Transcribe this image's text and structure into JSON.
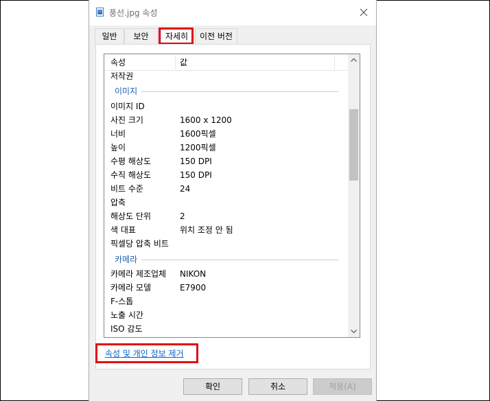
{
  "window": {
    "title": "풍선.jpg 속성"
  },
  "tabs": [
    {
      "label": "일반",
      "active": false
    },
    {
      "label": "보안",
      "active": false
    },
    {
      "label": "자세히",
      "active": true
    },
    {
      "label": "이전 버전",
      "active": false
    }
  ],
  "list": {
    "headers": {
      "name": "속성",
      "value": "값"
    },
    "top_rows": [
      {
        "name": "저작권",
        "value": ""
      }
    ],
    "group_image": {
      "label": "이미지",
      "rows": [
        {
          "name": "이미지 ID",
          "value": ""
        },
        {
          "name": "사진 크기",
          "value": "1600 x 1200"
        },
        {
          "name": "너비",
          "value": "1600픽셀"
        },
        {
          "name": "높이",
          "value": "1200픽셀"
        },
        {
          "name": "수평 해상도",
          "value": "150 DPI"
        },
        {
          "name": "수직 해상도",
          "value": "150 DPI"
        },
        {
          "name": "비트 수준",
          "value": "24"
        },
        {
          "name": "압축",
          "value": ""
        },
        {
          "name": "해상도 단위",
          "value": "2"
        },
        {
          "name": "색 대표",
          "value": "위치 조정 안 됨"
        },
        {
          "name": "픽셀당 압축 비트",
          "value": ""
        }
      ]
    },
    "group_camera": {
      "label": "카메라",
      "rows": [
        {
          "name": "카메라 제조업체",
          "value": "NIKON"
        },
        {
          "name": "카메라 모델",
          "value": "E7900"
        },
        {
          "name": "F-스톱",
          "value": ""
        },
        {
          "name": "노출 시간",
          "value": ""
        },
        {
          "name": "ISO 감도",
          "value": ""
        }
      ]
    }
  },
  "remove_link": "속성 및 개인 정보 제거",
  "buttons": {
    "ok": "확인",
    "cancel": "취소",
    "apply": "적용(A)"
  },
  "colors": {
    "highlight": "#e30613",
    "link": "#0066cc",
    "group_label": "#1e5eae"
  },
  "icons": {
    "title": "image-file-icon",
    "close": "close-icon",
    "scroll_up": "chevron-up-icon",
    "scroll_down": "chevron-down-icon"
  }
}
